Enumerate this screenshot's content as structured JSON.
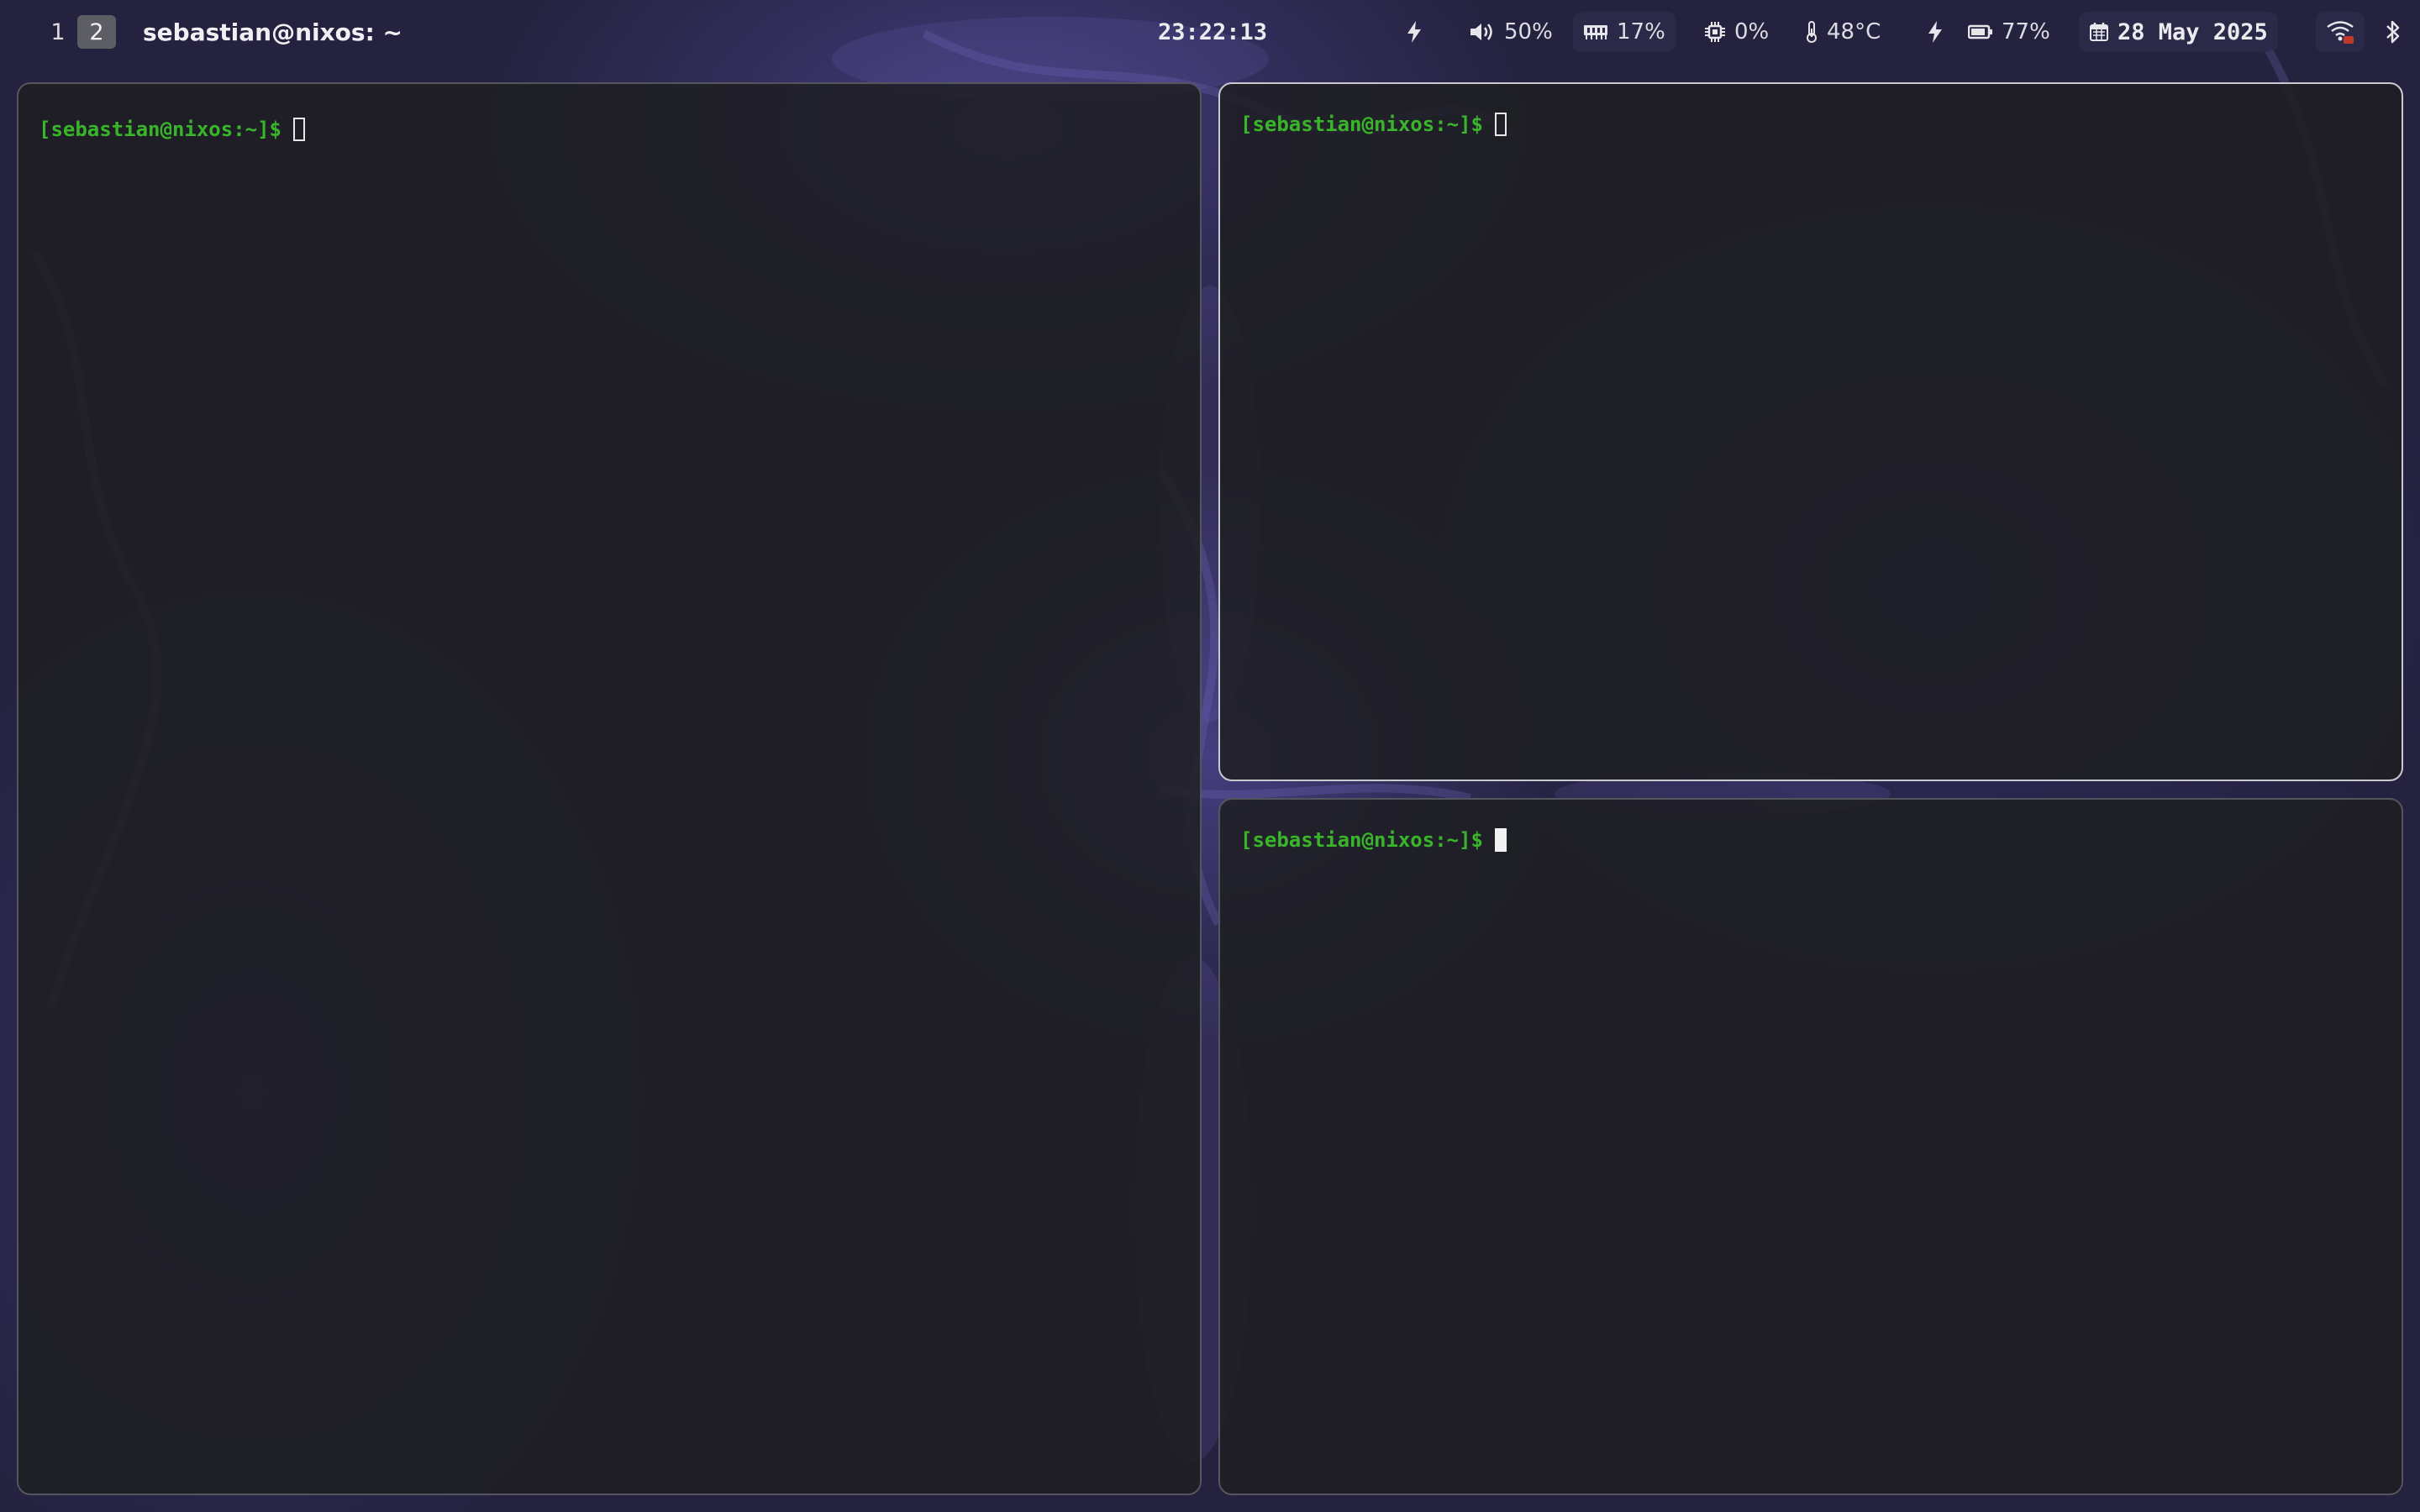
{
  "workspaces": [
    {
      "label": "1",
      "active": false
    },
    {
      "label": "2",
      "active": true
    }
  ],
  "window_title": "sebastian@nixos: ~",
  "clock": "23:22:13",
  "status": {
    "volume": "50%",
    "memory": "17%",
    "cpu": "0%",
    "temperature": "48°C",
    "battery": "77%",
    "date": "28 May 2025"
  },
  "icons": {
    "power_profile": "lightning-icon",
    "volume": "speaker-icon",
    "memory": "memory-chip-icon",
    "cpu": "cpu-icon",
    "temperature": "thermometer-icon",
    "charging": "lightning-icon",
    "battery": "battery-icon",
    "calendar": "calendar-icon",
    "wifi": "wifi-icon",
    "bluetooth": "bluetooth-icon"
  },
  "terminals": {
    "left": {
      "prompt": "[sebastian@nixos:~]$",
      "cursor": "hollow"
    },
    "top_right": {
      "prompt": "[sebastian@nixos:~]$",
      "cursor": "hollow",
      "focused": true
    },
    "bottom_right": {
      "prompt": "[sebastian@nixos:~]$",
      "cursor": "block"
    }
  },
  "colors": {
    "prompt_green": "#39b52a",
    "bar_text": "#e6e6ea",
    "workspace_active_bg": "#5d5d65",
    "focused_border": "#c9c9cf",
    "unfocused_border": "#55555e"
  }
}
